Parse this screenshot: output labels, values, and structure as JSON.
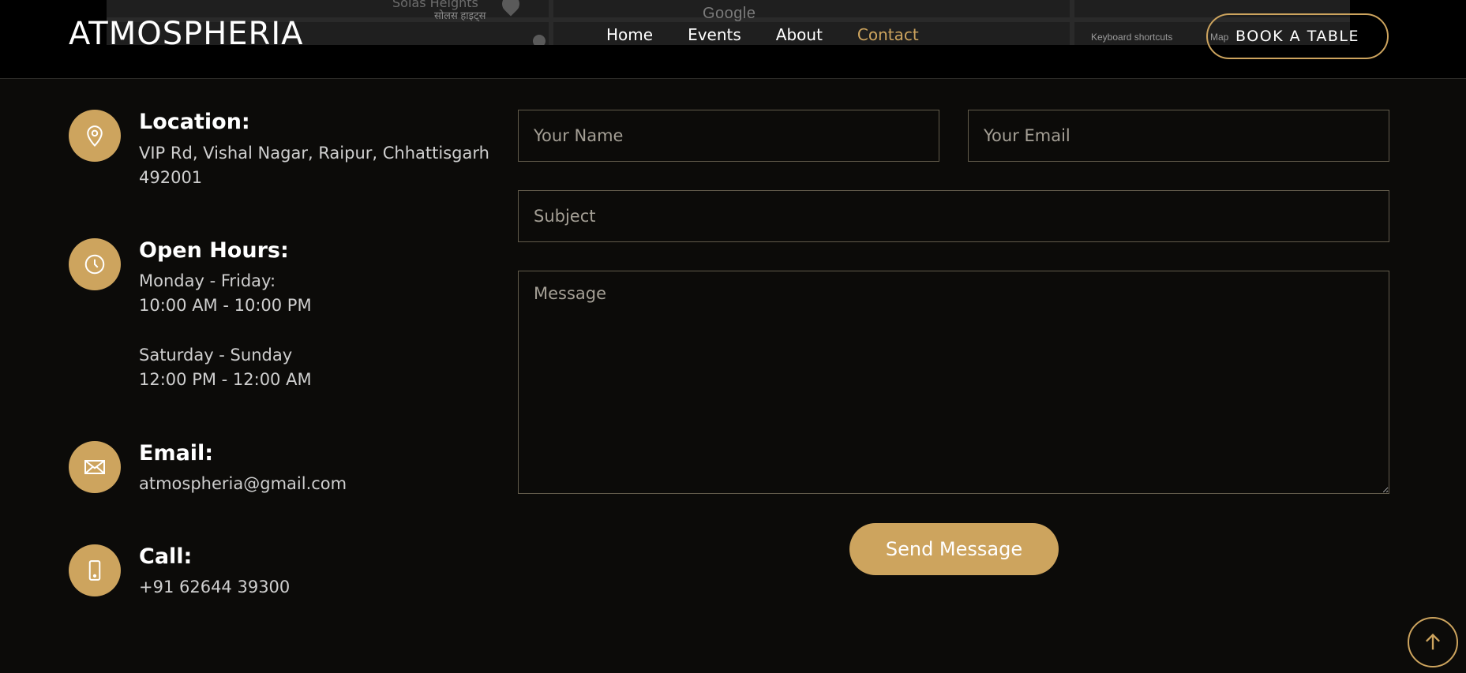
{
  "header": {
    "logo": "ATMOSPHERIA",
    "nav": [
      {
        "label": "Home",
        "active": false
      },
      {
        "label": "Events",
        "active": false
      },
      {
        "label": "About",
        "active": false
      },
      {
        "label": "Contact",
        "active": true
      }
    ],
    "book_button": "BOOK A TABLE",
    "map": {
      "place_label": "Solas Heights",
      "place_label_hindi": "सोलस हाइट्स",
      "google_logo": "Google",
      "keyboard_shortcuts": "Keyboard shortcuts",
      "map_data": "Map"
    }
  },
  "info": {
    "location": {
      "title": "Location:",
      "line1": "VIP Rd, Vishal Nagar, Raipur, Chhattisgarh",
      "line2": "492001",
      "icon": "map-pin-icon"
    },
    "hours": {
      "title": "Open Hours:",
      "weekday_label": "Monday - Friday:",
      "weekday_time": "10:00 AM - 10:00 PM",
      "weekend_label": "Saturday - Sunday",
      "weekend_time": "12:00 PM - 12:00 AM",
      "icon": "clock-icon"
    },
    "email": {
      "title": "Email:",
      "value": "atmospheria@gmail.com",
      "icon": "envelope-icon"
    },
    "call": {
      "title": "Call:",
      "value": "+91 62644 39300",
      "icon": "phone-icon"
    }
  },
  "form": {
    "name_placeholder": "Your Name",
    "email_placeholder": "Your Email",
    "subject_placeholder": "Subject",
    "message_placeholder": "Message",
    "send_button": "Send Message"
  },
  "colors": {
    "accent": "#cda45e",
    "background": "#0c0b09",
    "header": "#000000"
  }
}
